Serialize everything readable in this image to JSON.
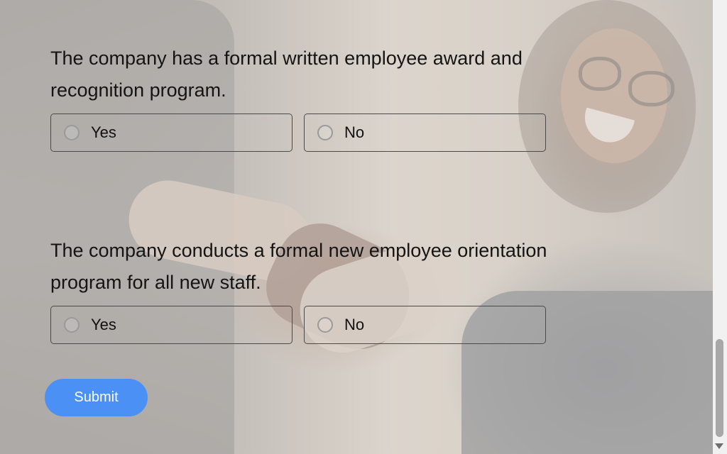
{
  "questions": [
    {
      "text": "The company has a formal written employee award and recognition program.",
      "options": [
        "Yes",
        "No"
      ]
    },
    {
      "text": "The company conducts a formal new employee orientation program for all new staff.",
      "options": [
        "Yes",
        "No"
      ]
    }
  ],
  "submit_label": "Submit",
  "colors": {
    "accent": "#4a90f5",
    "text": "#141414",
    "border": "#4a4a4a"
  },
  "icons": {
    "radio": "radio-circle-icon",
    "scroll_down": "chevron-down-icon"
  }
}
